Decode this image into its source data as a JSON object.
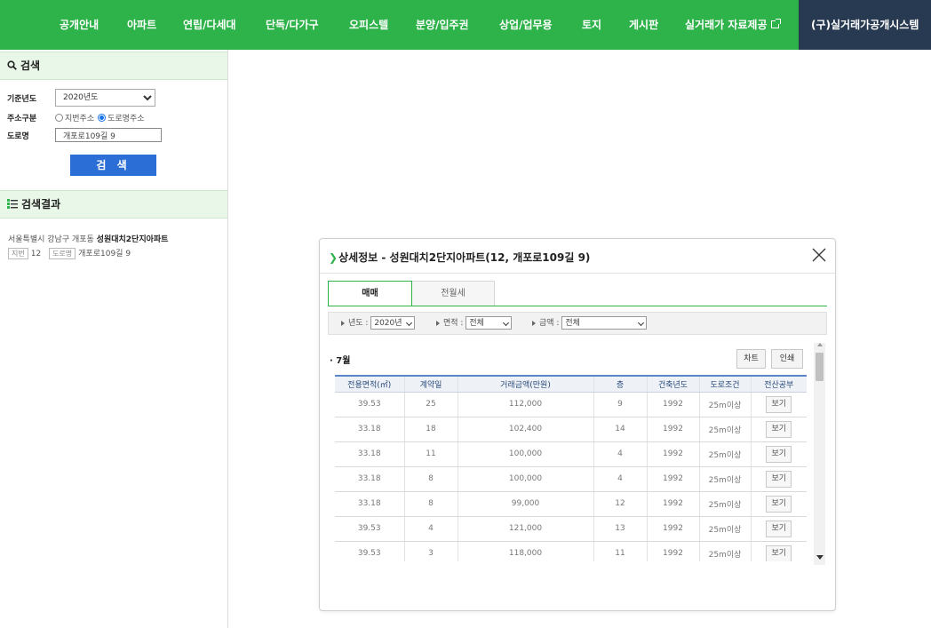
{
  "nav": {
    "items": [
      "공개안내",
      "아파트",
      "연립/다세대",
      "단독/다가구",
      "오피스텔",
      "분양/입주권",
      "상업/업무용",
      "토지",
      "게시판",
      "실거래가 자료제공"
    ],
    "dark_item": "(구)실거래가공개시스템"
  },
  "search": {
    "title": "검색",
    "year_label": "기준년도",
    "year_value": "2020년도",
    "address_type_label": "주소구분",
    "opt_jibun": "지번주소",
    "opt_road": "도로명주소",
    "road_label": "도로명",
    "road_value": "개포로109길 9",
    "button": "검 색"
  },
  "results": {
    "title": "검색결과",
    "line1_prefix": "서울특별시 강남구 개포동 ",
    "line1_name": "성원대치2단지아파트",
    "tag_jibun": "지번",
    "jibun_value": "12",
    "tag_road": "도로명",
    "road_value": "개포로109길 9"
  },
  "modal": {
    "title": "상세정보 - 성원대치2단지아파트(12, 개포로109길 9)",
    "tab_sale": "매매",
    "tab_rent": "전월세",
    "filter_year_label": "년도 :",
    "filter_year_value": "2020년",
    "filter_area_label": "면적 :",
    "filter_area_value": "전체",
    "filter_price_label": "금액 :",
    "filter_price_value": "전체",
    "month": "· 7월",
    "btn_chart": "차트",
    "btn_print": "인쇄",
    "columns": [
      "전용면적(㎡)",
      "계약일",
      "거래금액(만원)",
      "층",
      "건축년도",
      "도로조건",
      "전산공부"
    ],
    "rows": [
      [
        "39.53",
        "25",
        "112,000",
        "9",
        "1992",
        "25m이상",
        "보기"
      ],
      [
        "33.18",
        "18",
        "102,400",
        "14",
        "1992",
        "25m이상",
        "보기"
      ],
      [
        "33.18",
        "11",
        "100,000",
        "4",
        "1992",
        "25m이상",
        "보기"
      ],
      [
        "33.18",
        "8",
        "100,000",
        "4",
        "1992",
        "25m이상",
        "보기"
      ],
      [
        "33.18",
        "8",
        "99,000",
        "12",
        "1992",
        "25m이상",
        "보기"
      ],
      [
        "39.53",
        "4",
        "121,000",
        "13",
        "1992",
        "25m이상",
        "보기"
      ],
      [
        "39.53",
        "3",
        "118,000",
        "11",
        "1992",
        "25m이상",
        "보기"
      ]
    ]
  },
  "colors": {
    "brand_green": "#2eb24a",
    "nav_dark": "#283a52",
    "button_blue": "#2b6fd6"
  }
}
